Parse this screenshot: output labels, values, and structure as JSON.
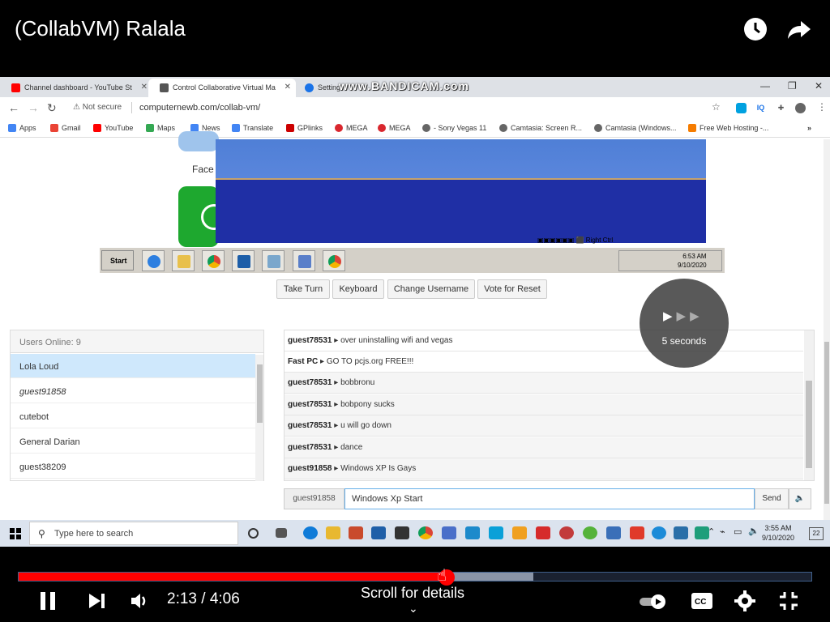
{
  "youtube": {
    "title": "(CollabVM) Ralala",
    "time_display": "2:13 / 4:06",
    "scroll_hint": "Scroll for details",
    "progress_fraction": 0.54,
    "buffered_fraction": 0.649,
    "icons": [
      "watch-later-icon",
      "share-icon",
      "pause-icon",
      "next-icon",
      "volume-icon",
      "autoplay-toggle",
      "captions-icon",
      "settings-icon",
      "fullscreen-exit-icon"
    ]
  },
  "browser": {
    "tabs": [
      {
        "label": "Channel dashboard - YouTube St",
        "icon_color": "#ff0000"
      },
      {
        "label": "Control Collaborative Virtual Ma",
        "icon_color": "#555555"
      },
      {
        "label": "Setting",
        "icon_color": "#1a73e8"
      }
    ],
    "watermark": "www.BANDICAM.com",
    "security_label": "Not secure",
    "url": "computernewb.com/collab-vm/",
    "bookmarks": [
      {
        "label": "Apps",
        "color": "#4285f4"
      },
      {
        "label": "Gmail",
        "color": "#ea4335"
      },
      {
        "label": "YouTube",
        "color": "#ff0000"
      },
      {
        "label": "Maps",
        "color": "#34a853"
      },
      {
        "label": "News",
        "color": "#4285f4"
      },
      {
        "label": "Translate",
        "color": "#4285f4"
      },
      {
        "label": "GPlinks",
        "color": "#cc0000"
      },
      {
        "label": "MEGA",
        "color": "#d9272e"
      },
      {
        "label": "MEGA",
        "color": "#d9272e"
      },
      {
        "label": "- Sony Vegas 11",
        "color": "#666666"
      },
      {
        "label": "Camtasia: Screen R...",
        "color": "#666666"
      },
      {
        "label": "Camtasia (Windows...",
        "color": "#666666"
      },
      {
        "label": "Free Web Hosting -...",
        "color": "#f57c00"
      }
    ]
  },
  "site": {
    "face_label": "Face"
  },
  "vm": {
    "start_label": "Start",
    "status_right": "Right Ctrl",
    "clock_time": "6:53 AM",
    "clock_date": "9/10/2020"
  },
  "controls": {
    "take_turn": "Take Turn",
    "keyboard": "Keyboard",
    "change_username": "Change Username",
    "vote_reset": "Vote for Reset"
  },
  "timer": {
    "label": "5 seconds"
  },
  "users": {
    "header": "Users Online: 9",
    "list": [
      {
        "name": "Lola Loud",
        "selected": true,
        "italic": false
      },
      {
        "name": "guest91858",
        "selected": false,
        "italic": true
      },
      {
        "name": "cutebot",
        "selected": false,
        "italic": false
      },
      {
        "name": "General Darian",
        "selected": false,
        "italic": false
      },
      {
        "name": "guest38209",
        "selected": false,
        "italic": false
      }
    ]
  },
  "chat": {
    "messages": [
      {
        "user": "guest78531",
        "text": "over uninstalling wifi and vegas"
      },
      {
        "user": "Fast PC",
        "text": "GO TO pcjs.org FREE!!!"
      },
      {
        "user": "guest78531",
        "text": "bobbronu"
      },
      {
        "user": "guest78531",
        "text": "bobpony sucks"
      },
      {
        "user": "guest78531",
        "text": "u will go down"
      },
      {
        "user": "guest78531",
        "text": "dance"
      },
      {
        "user": "guest91858",
        "text": "Windows XP Is Gays"
      }
    ],
    "username": "guest91858",
    "input_value": "Windows Xp Start",
    "send_label": "Send"
  },
  "windows": {
    "search_placeholder": "Type here to search",
    "clock_time": "3:55 AM",
    "clock_date": "9/10/2020",
    "notification_count": "22"
  }
}
